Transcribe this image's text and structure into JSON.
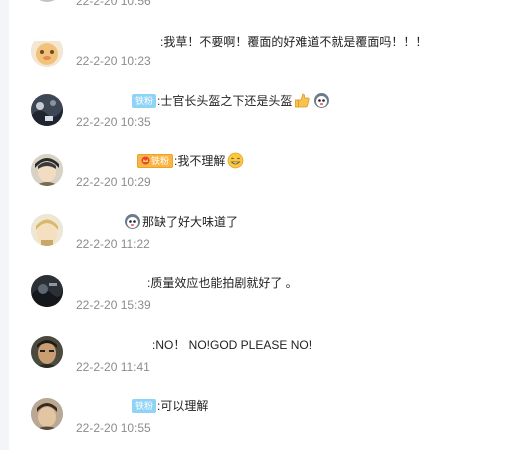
{
  "comments": [
    {
      "time": "22-2-20 10:56",
      "content": ""
    },
    {
      "time": "22-2-20 10:23",
      "content": ":我草！不要啊！覆面的好难道不就是覆面吗！！！"
    },
    {
      "time": "22-2-20 10:35",
      "badge": "铁粉",
      "content": ":士官长头盔之下还是头盔"
    },
    {
      "time": "22-2-20 10:29",
      "badge": "铁粉",
      "content": ":我不理解"
    },
    {
      "time": "22-2-20 11:22",
      "content": "那缺了好大味道了"
    },
    {
      "time": "22-2-20 15:39",
      "content": ":质量效应也能拍剧就好了 。"
    },
    {
      "time": "22-2-20 11:41",
      "content": ":NO！ NO!GOD PLEASE NO!"
    },
    {
      "time": "22-2-20 10:55",
      "badge": "铁粉",
      "content": ":可以理解"
    }
  ],
  "icons": {
    "thumbs_up": "thumbs-up-emoji",
    "ghost": "ghost-emoji",
    "grin": "grin-emoji",
    "fan_crown": "fan-crown-icon"
  },
  "colors": {
    "badge_blue": "#8fd3f6",
    "badge_gold": "#f7b646",
    "time_gray": "#8c8c8c"
  }
}
